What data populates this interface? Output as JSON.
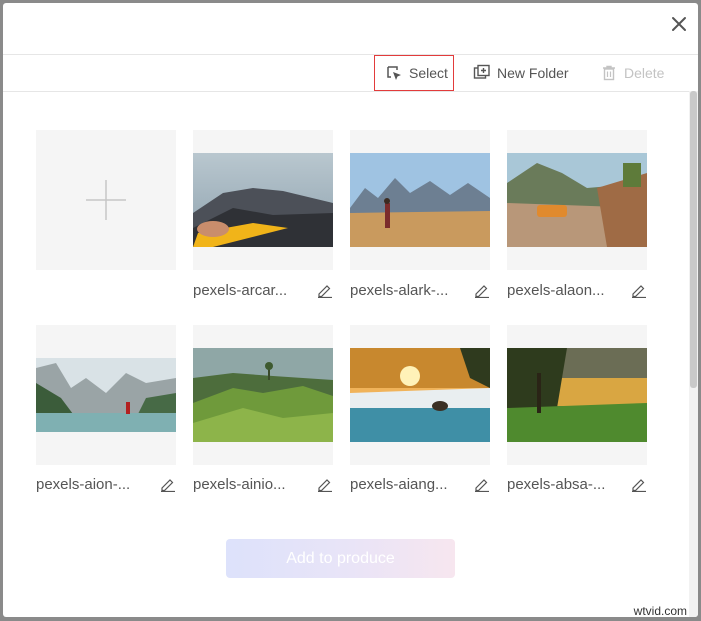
{
  "toolbar": {
    "select_label": "Select",
    "new_folder_label": "New Folder",
    "delete_label": "Delete"
  },
  "media": [
    {
      "name": "pexels-arcar..."
    },
    {
      "name": "pexels-alark-..."
    },
    {
      "name": "pexels-alaon..."
    },
    {
      "name": "pexels-aion-..."
    },
    {
      "name": "pexels-ainio..."
    },
    {
      "name": "pexels-aiang..."
    },
    {
      "name": "pexels-absa-..."
    }
  ],
  "footer": {
    "add_button_label": "Add to produce"
  },
  "watermark": "wtvid.com",
  "colors": {
    "select_outline": "#e23b3b",
    "disabled_text": "#c3c3c3"
  }
}
